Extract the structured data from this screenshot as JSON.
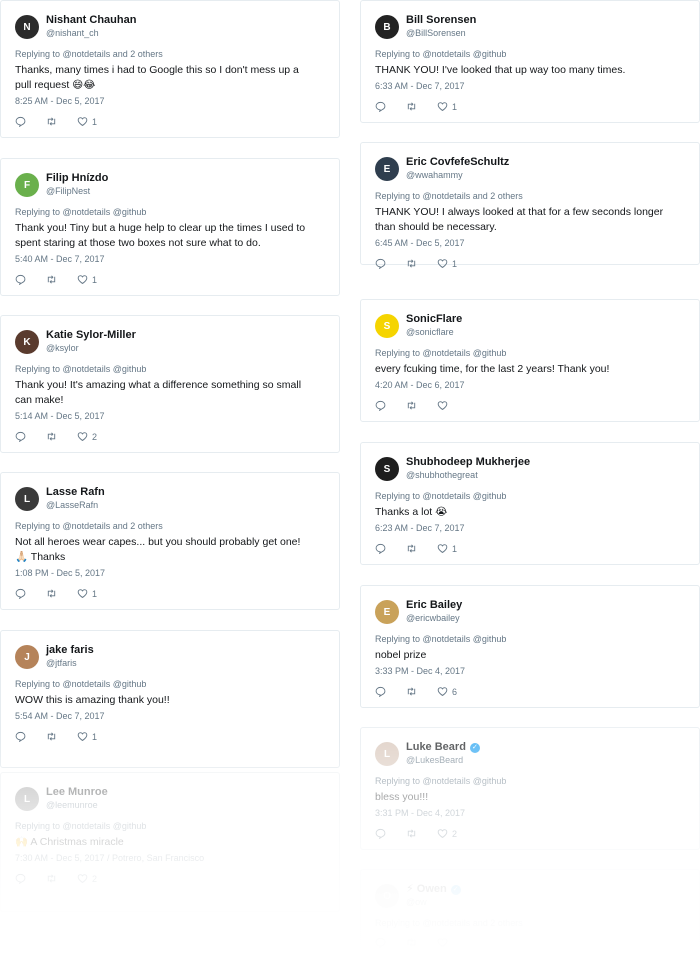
{
  "left": [
    {
      "name": "Nishant Chauhan",
      "handle": "@nishant_ch",
      "reply": "Replying to @notdetails and 2 others",
      "text": "Thanks, many times i had to Google this so I don't mess up a\npull request 😄😂",
      "meta": "8:25 AM - Dec 5, 2017",
      "likes": "1",
      "avatar_color": "#2b2b2b",
      "initial": "N"
    },
    {
      "name": "Filip Hnízdo",
      "handle": "@FilipNest",
      "reply": "Replying to @notdetails @github",
      "text": "Thank you! Tiny but a huge help to clear up the times I used to\nspent staring at those two boxes not sure what to do.",
      "meta": "5:40 AM - Dec 7, 2017",
      "likes": "1",
      "avatar_color": "#6ab04c",
      "initial": "F"
    },
    {
      "name": "Katie Sylor-Miller",
      "handle": "@ksylor",
      "reply": "Replying to @notdetails @github",
      "text": "Thank you! It's amazing what a difference something so small\ncan make!",
      "meta": "5:14 AM - Dec 5, 2017",
      "likes": "2",
      "avatar_color": "#5a3b2e",
      "initial": "K"
    },
    {
      "name": "Lasse Rafn",
      "handle": "@LasseRafn",
      "reply": "Replying to @notdetails and 2 others",
      "text": "Not all heroes wear capes... but you should probably get one!\n🙏🏻 Thanks",
      "meta": "1:08 PM - Dec 5, 2017",
      "likes": "1",
      "avatar_color": "#3a3a3a",
      "initial": "L"
    },
    {
      "name": "jake faris",
      "handle": "@jtfaris",
      "reply": "Replying to @notdetails @github",
      "text": "WOW this is amazing thank you!!",
      "meta": "5:54 AM - Dec 7, 2017",
      "likes": "1",
      "avatar_color": "#b5835a",
      "initial": "J"
    },
    {
      "name": "Lee Munroe",
      "handle": "@leemunroe",
      "reply": "Replying to @notdetails @github",
      "text": "🙌 A Christmas miracle",
      "meta": "7:30 AM - Dec 5, 2017 / Potrero, San Francisco",
      "likes": "2",
      "avatar_color": "#888888",
      "initial": "L"
    }
  ],
  "right": [
    {
      "name": "Bill Sorensen",
      "handle": "@BillSorensen",
      "reply": "Replying to @notdetails @github",
      "text": "THANK YOU! I've looked that up way too many times.",
      "meta": "6:33 AM - Dec 7, 2017",
      "likes": "1",
      "avatar_color": "#222222",
      "initial": "B",
      "verified": false
    },
    {
      "name": "Eric CovfefeSchultz",
      "handle": "@wwahammy",
      "reply": "Replying to @notdetails and 2 others",
      "text": "THANK YOU! I always looked at that for a few seconds longer\nthan should be necessary.",
      "meta": "6:45 AM - Dec 5, 2017",
      "likes": "1",
      "avatar_color": "#2f3e4e",
      "initial": "E",
      "verified": false
    },
    {
      "name": "SonicFlare",
      "handle": "@sonicflare",
      "reply": "Replying to @notdetails @github",
      "text": "every fcuking time, for the last 2 years! Thank you!",
      "meta": "4:20 AM - Dec 6, 2017",
      "likes": "",
      "avatar_color": "#f5d400",
      "initial": "S",
      "verified": false
    },
    {
      "name": "Shubhodeep Mukherjee",
      "handle": "@shubhothegreat",
      "reply": "Replying to @notdetails @github",
      "text": "Thanks a lot 😭",
      "meta": "6:23 AM - Dec 7, 2017",
      "likes": "1",
      "avatar_color": "#1e1e1e",
      "initial": "S",
      "verified": false
    },
    {
      "name": "Eric Bailey",
      "handle": "@ericwbailey",
      "reply": "Replying to @notdetails @github",
      "text": "nobel prize",
      "meta": "3:33 PM - Dec 4, 2017",
      "likes": "6",
      "avatar_color": "#c9a25a",
      "initial": "E",
      "verified": false
    },
    {
      "name": "Luke Beard",
      "handle": "@LukesBeard",
      "reply": "Replying to @notdetails @github",
      "text": "bless you!!!",
      "meta": "3:31 PM - Dec 4, 2017",
      "likes": "2",
      "avatar_color": "#d8c6b8",
      "initial": "L",
      "verified": true
    },
    {
      "name": "⚡ Owen",
      "handle": "@ow",
      "reply": "Replying to @notdetails and 2 others",
      "text": "",
      "meta": "",
      "likes": "",
      "avatar_color": "#cccccc",
      "initial": "O",
      "verified": true
    }
  ]
}
